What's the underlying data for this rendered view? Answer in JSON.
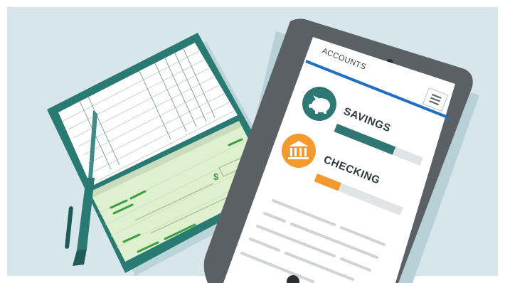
{
  "tablet": {
    "header": "ACCOUNTS",
    "menu_icon": "hamburger-menu-icon",
    "accounts": [
      {
        "label": "SAVINGS",
        "icon": "piggy-bank-icon",
        "icon_color": "#2e7773",
        "bar_color": "#2e7773",
        "level": 0.68
      },
      {
        "label": "CHECKING",
        "icon": "bank-building-icon",
        "icon_color": "#f29a2e",
        "bar_color": "#f29a2e",
        "level": 0.28
      }
    ]
  },
  "checkbook": {
    "icon": "dollar-sign-icon"
  },
  "colors": {
    "background": "#d6e6ea",
    "tablet_frame": "#5a6064",
    "checkbook_cover": "#2a7a74",
    "check_paper": "#dff0cf",
    "accent_blue": "#1f6fc2"
  }
}
